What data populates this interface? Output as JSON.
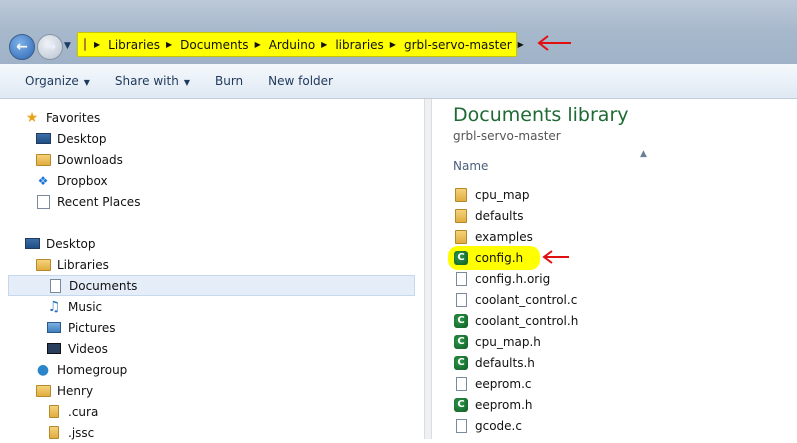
{
  "address": {
    "crumbs": [
      "Libraries",
      "Documents",
      "Arduino",
      "libraries",
      "grbl-servo-master"
    ],
    "highlight_color": "#ffff00",
    "annotation_color": "#e01010"
  },
  "toolbar": {
    "organize": "Organize",
    "share_with": "Share with",
    "burn": "Burn",
    "new_folder": "New folder"
  },
  "nav": {
    "favorites": {
      "label": "Favorites",
      "items": [
        "Desktop",
        "Downloads",
        "Dropbox",
        "Recent Places"
      ]
    },
    "tree": {
      "desktop": "Desktop",
      "libraries": "Libraries",
      "documents": "Documents",
      "music": "Music",
      "pictures": "Pictures",
      "videos": "Videos",
      "homegroup": "Homegroup",
      "henry": "Henry",
      "cura": ".cura",
      "jssc": ".jssc"
    }
  },
  "content": {
    "title": "Documents library",
    "subtitle": "grbl-servo-master",
    "column_name": "Name",
    "files": [
      {
        "name": "cpu_map",
        "icon": "folder-icon"
      },
      {
        "name": "defaults",
        "icon": "folder-icon"
      },
      {
        "name": "examples",
        "icon": "folder-icon"
      },
      {
        "name": "config.h",
        "icon": "c-header-icon"
      },
      {
        "name": "config.h.orig",
        "icon": "document-icon"
      },
      {
        "name": "coolant_control.c",
        "icon": "document-icon"
      },
      {
        "name": "coolant_control.h",
        "icon": "c-header-icon"
      },
      {
        "name": "cpu_map.h",
        "icon": "c-header-icon"
      },
      {
        "name": "defaults.h",
        "icon": "c-header-icon"
      },
      {
        "name": "eeprom.c",
        "icon": "document-icon"
      },
      {
        "name": "eeprom.h",
        "icon": "c-header-icon"
      },
      {
        "name": "gcode.c",
        "icon": "document-icon"
      }
    ]
  }
}
